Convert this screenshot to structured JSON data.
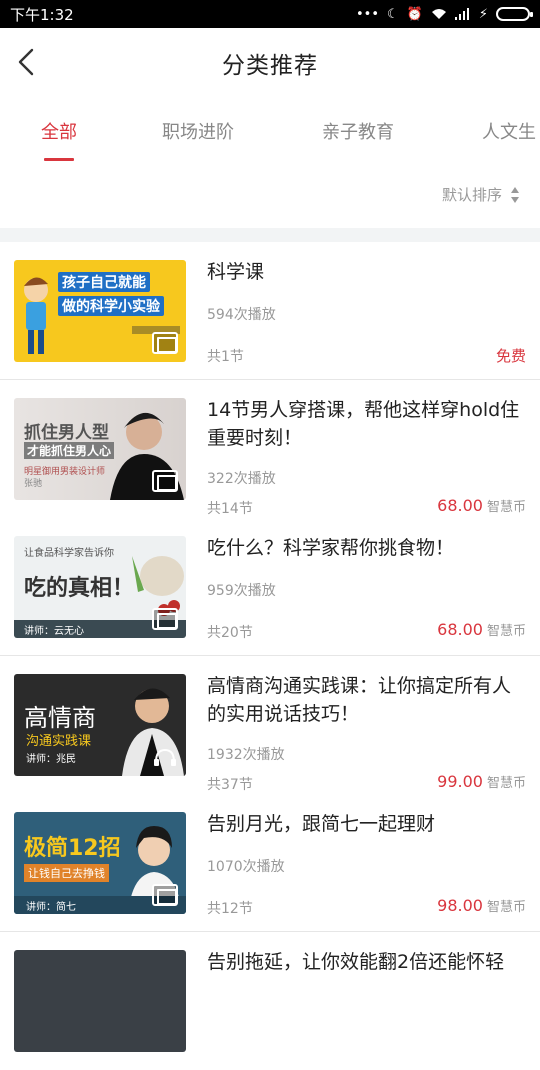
{
  "status_bar": {
    "time": "下午1:32",
    "signal_dots": "•••"
  },
  "header": {
    "title": "分类推荐"
  },
  "tabs": [
    {
      "label": "全部"
    },
    {
      "label": "职场进阶"
    },
    {
      "label": "亲子教育"
    },
    {
      "label": "人文生"
    }
  ],
  "sort": {
    "label": "默认排序"
  },
  "courses": [
    {
      "title": "科学课",
      "plays": "594次播放",
      "lessons": "共1节",
      "price": "免费",
      "currency": "",
      "thumb_lines": [
        "孩子自己就能",
        "做的科学小实验"
      ]
    },
    {
      "title": "14节男人穿搭课，帮他这样穿hold住重要时刻！",
      "plays": "322次播放",
      "lessons": "共14节",
      "price": "68.00",
      "currency": "智慧币",
      "thumb_lines": [
        "抓住男人型",
        "才能抓住男人心",
        "明星御用男装设计师",
        "张驰"
      ]
    },
    {
      "title": "吃什么？科学家帮你挑食物！",
      "plays": "959次播放",
      "lessons": "共20节",
      "price": "68.00",
      "currency": "智慧币",
      "thumb_lines": [
        "让食品科学家告诉你",
        "吃的真相！",
        "讲师：云无心"
      ]
    },
    {
      "title": "高情商沟通实践课：让你搞定所有人的实用说话技巧！",
      "plays": "1932次播放",
      "lessons": "共37节",
      "price": "99.00",
      "currency": "智慧币",
      "thumb_lines": [
        "高情商",
        "沟通实践课",
        "讲师：兆民"
      ]
    },
    {
      "title": "告别月光，跟简七一起理财",
      "plays": "1070次播放",
      "lessons": "共12节",
      "price": "98.00",
      "currency": "智慧币",
      "thumb_lines": [
        "极简12招",
        "让钱自己去挣钱",
        "讲师：简七"
      ]
    },
    {
      "title": "告别拖延，让你效能翻2倍还能怀轻",
      "plays": "",
      "lessons": "",
      "price": "",
      "currency": "",
      "thumb_lines": []
    }
  ]
}
